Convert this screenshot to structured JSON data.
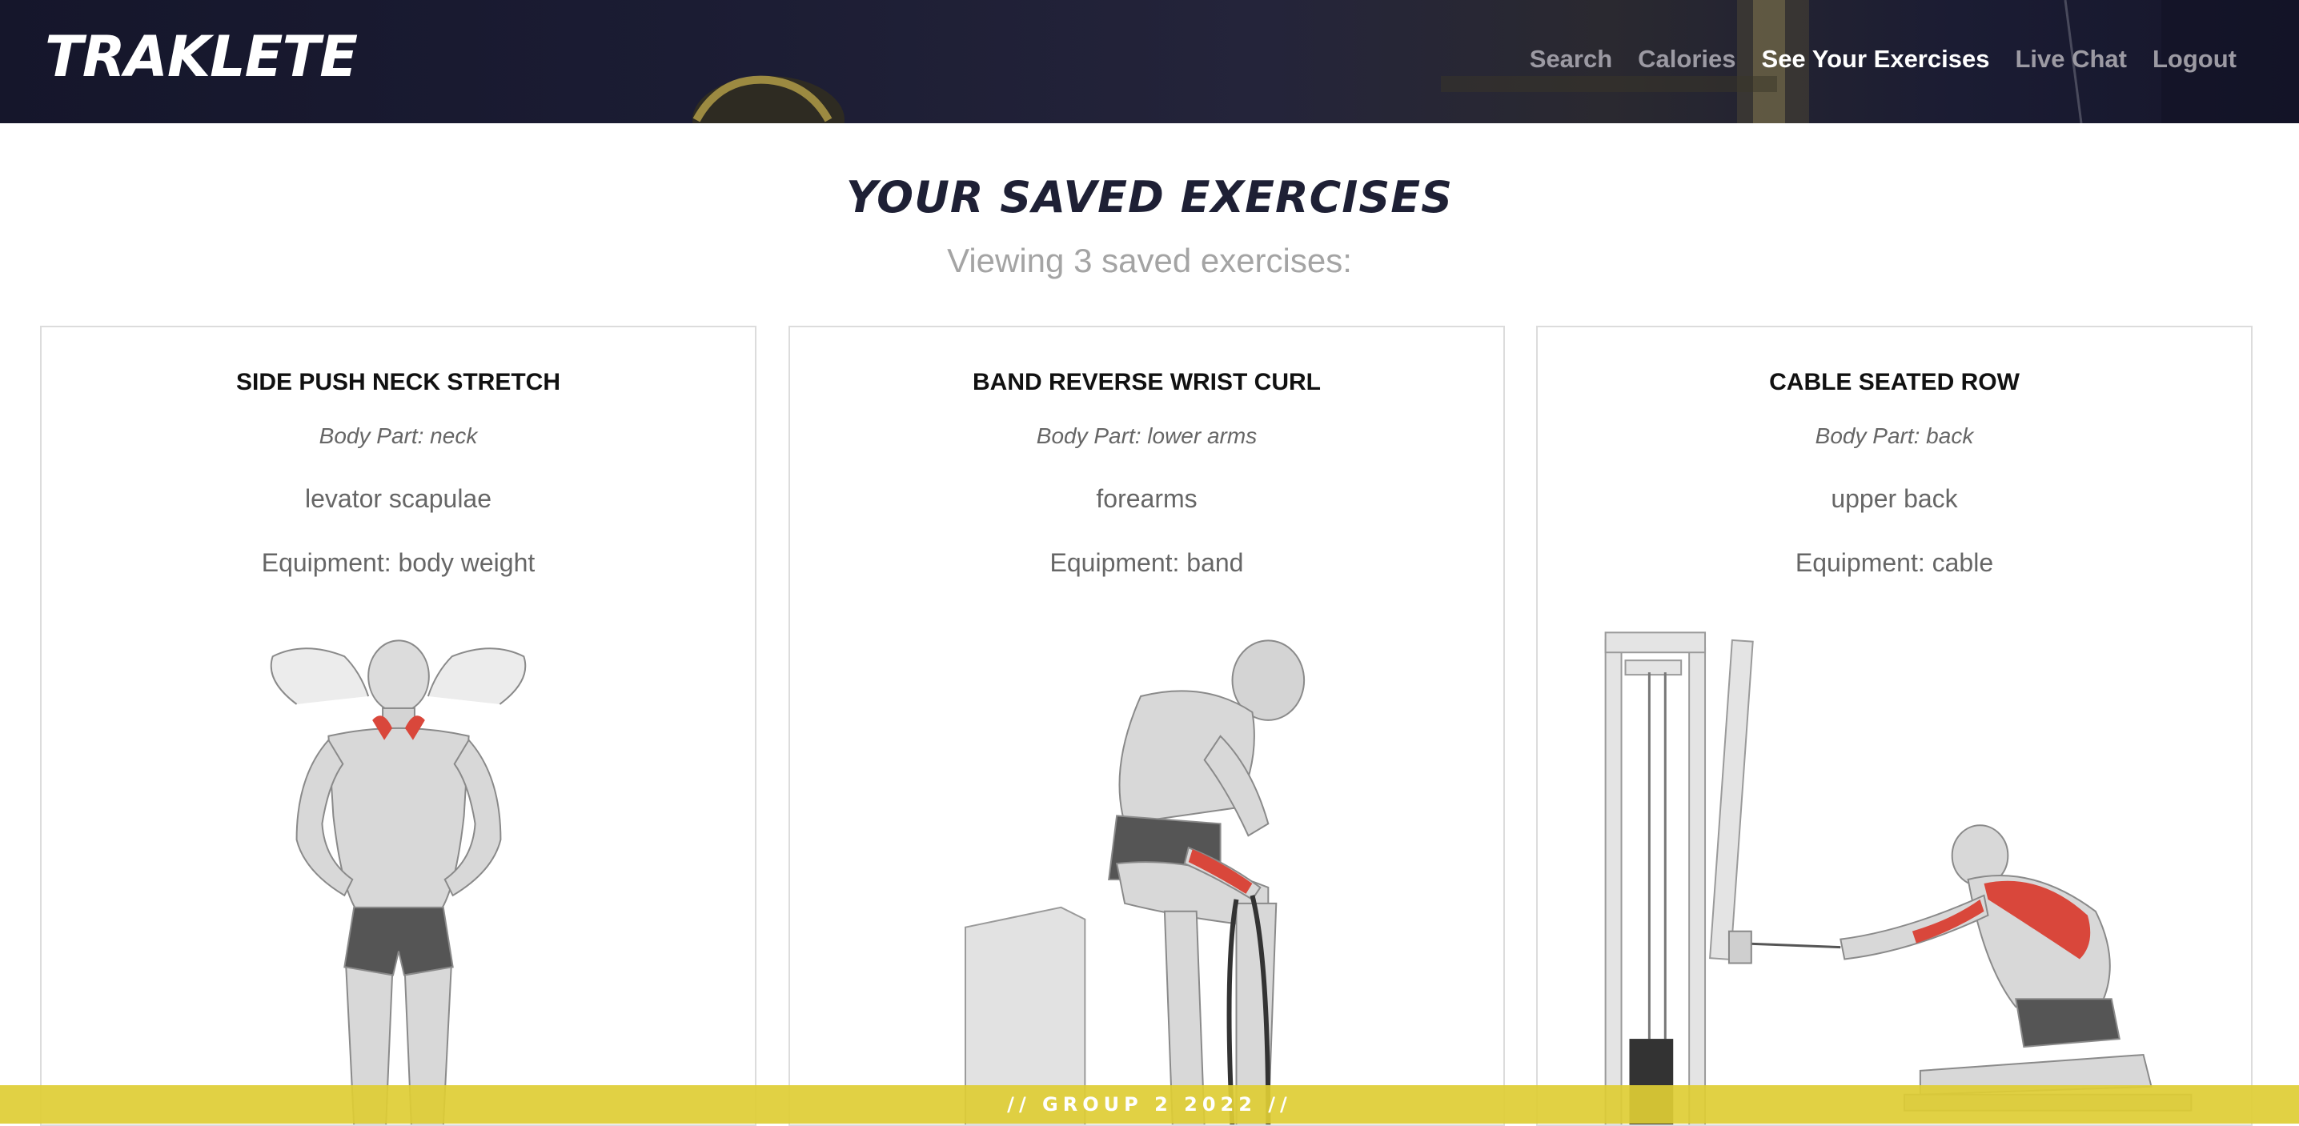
{
  "header": {
    "brand": "TRAKLETE",
    "nav": [
      {
        "label": "Search",
        "active": false
      },
      {
        "label": "Calories",
        "active": false
      },
      {
        "label": "See Your Exercises",
        "active": true
      },
      {
        "label": "Live Chat",
        "active": false
      },
      {
        "label": "Logout",
        "active": false
      }
    ]
  },
  "main": {
    "title": "YOUR SAVED EXERCISES",
    "subtitle": "Viewing 3 saved exercises:",
    "cards": [
      {
        "name": "SIDE PUSH NECK STRETCH",
        "body_part": "Body Part: neck",
        "target": "levator scapulae",
        "equipment": "Equipment: body weight",
        "illustration": "standing-neck-stretch-figure"
      },
      {
        "name": "BAND REVERSE WRIST CURL",
        "body_part": "Body Part: lower arms",
        "target": "forearms",
        "equipment": "Equipment: band",
        "illustration": "seated-wrist-curl-figure"
      },
      {
        "name": "CABLE SEATED ROW",
        "body_part": "Body Part: back",
        "target": "upper back",
        "equipment": "Equipment: cable",
        "illustration": "cable-row-figure"
      }
    ]
  },
  "footer": {
    "text": "// GROUP 2 2022 //"
  },
  "colors": {
    "header_bg": "#15162b",
    "title": "#1e2035",
    "nav_inactive": "#9c9aa3",
    "nav_active": "#ffffff",
    "muscle_highlight": "#d9473b",
    "footer_bg": "#decd34"
  }
}
